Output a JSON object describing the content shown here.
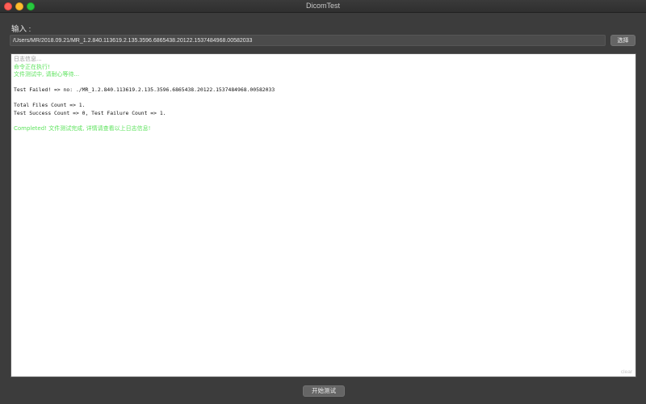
{
  "window": {
    "title": "DicomTest"
  },
  "input": {
    "label": "输入 :",
    "path_value": "/Users/MR/2018.09.21/MR_1.2.840.113619.2.135.3596.6865438.20122.1537484968.00582033",
    "choose_label": "选择"
  },
  "log": {
    "lines": [
      {
        "text": "日志信息...",
        "style": "gray"
      },
      {
        "text": "命令正在执行!",
        "style": "green"
      },
      {
        "text": "文件测试中, 请耐心等待...",
        "style": "green"
      },
      {
        "text": "",
        "style": "blank"
      },
      {
        "text": "Test Failed! => no: ./MR_1.2.840.113619.2.135.3596.6865438.20122.1537484968.00582033",
        "style": "mono"
      },
      {
        "text": "",
        "style": "blank"
      },
      {
        "text": "Total Files Count => 1.",
        "style": "mono"
      },
      {
        "text": "Test Success Count => 0, Test Failure Count => 1.",
        "style": "mono"
      },
      {
        "text": "",
        "style": "blank"
      },
      {
        "text": "Completed! 文件测试完成, 详情请查看以上日志信息!",
        "style": "green"
      }
    ],
    "clear_label": "clear"
  },
  "actions": {
    "start_label": "开始测试"
  },
  "colors": {
    "background": "#3c3c3c",
    "log_green": "#5ee35e",
    "log_gray": "#9a9a9a"
  }
}
